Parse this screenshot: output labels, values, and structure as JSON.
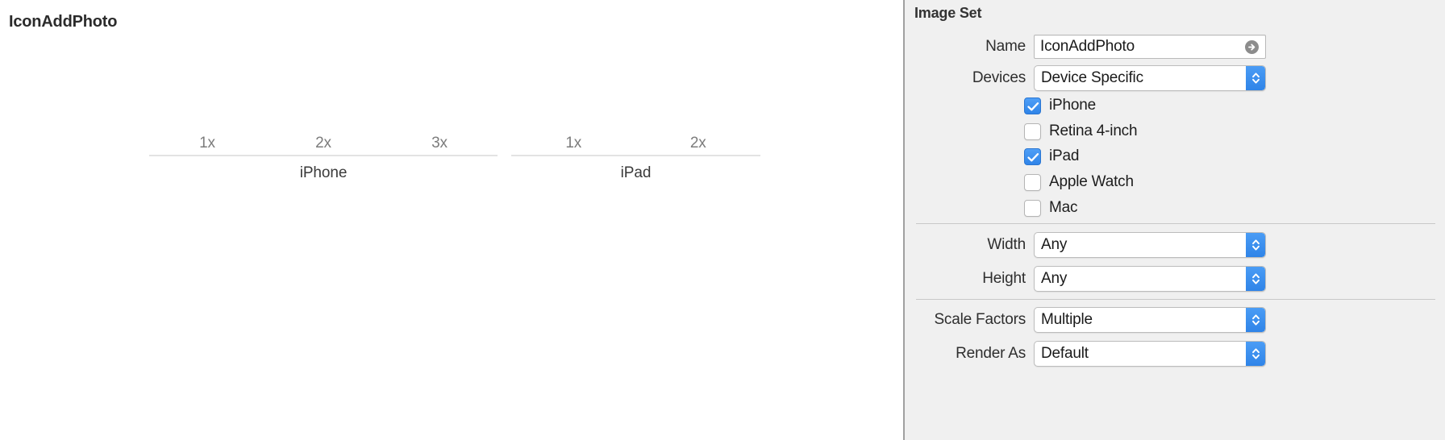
{
  "canvas": {
    "asset_title": "IconAddPhoto",
    "groups": [
      {
        "name": "iPhone",
        "slots": [
          {
            "label": "1x"
          },
          {
            "label": "2x"
          },
          {
            "label": "3x"
          }
        ]
      },
      {
        "name": "iPad",
        "slots": [
          {
            "label": "1x"
          },
          {
            "label": "2x"
          }
        ]
      }
    ]
  },
  "inspector": {
    "title": "Image Set",
    "name_row": {
      "label": "Name",
      "value": "IconAddPhoto",
      "accessory_icon": "arrow-right-circle-icon"
    },
    "devices_row": {
      "label": "Devices",
      "value": "Device Specific"
    },
    "device_checkboxes": [
      {
        "label": "iPhone",
        "checked": true
      },
      {
        "label": "Retina 4-inch",
        "checked": false
      },
      {
        "label": "iPad",
        "checked": true
      },
      {
        "label": "Apple Watch",
        "checked": false
      },
      {
        "label": "Mac",
        "checked": false
      }
    ],
    "width_row": {
      "label": "Width",
      "value": "Any"
    },
    "height_row": {
      "label": "Height",
      "value": "Any"
    },
    "scale_factors_row": {
      "label": "Scale Factors",
      "value": "Multiple"
    },
    "render_as_row": {
      "label": "Render As",
      "value": "Default"
    }
  },
  "colors": {
    "accent_blue": "#2f84e8",
    "panel_bg": "#f0f0f0",
    "canvas_bg": "#ffffff",
    "slot_label": "#7c7c7c",
    "rule": "#e3e3e3"
  }
}
